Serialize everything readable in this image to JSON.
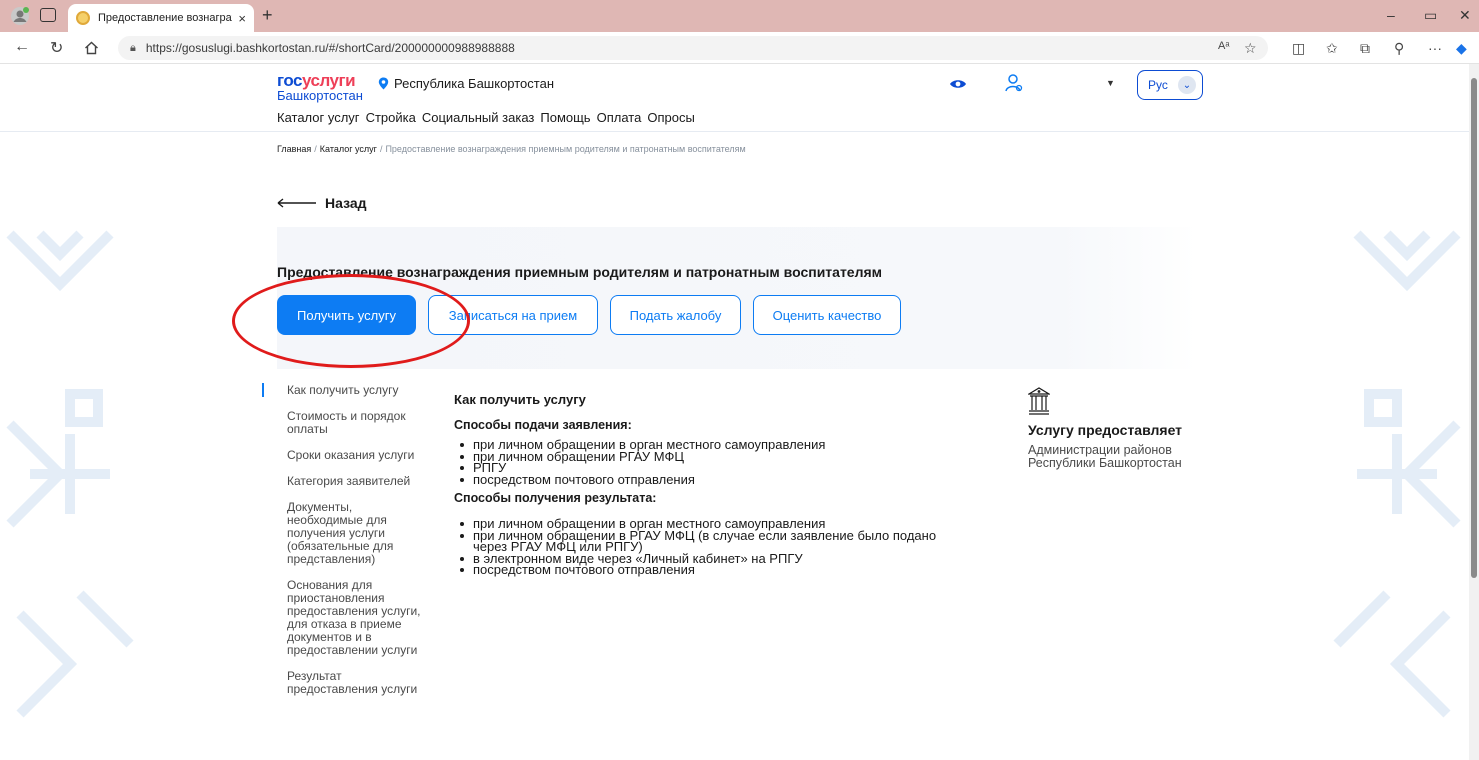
{
  "browser": {
    "tab_title": "Предоставление вознагражден",
    "tab_close": "×",
    "new_tab": "+",
    "url": "https://gosuslugi.bashkortostan.ru/#/shortCard/200000000988988888",
    "controls": {
      "minimize": "–",
      "maximize": "▭",
      "close": "✕"
    },
    "toolbar_icons": [
      "read-aloud-icon",
      "favorite-star-icon",
      "split-screen-icon",
      "favorites-icon",
      "collections-icon",
      "extensions-icon",
      "more-icon",
      "copilot-icon"
    ]
  },
  "header": {
    "logo_line1_a": "гос",
    "logo_line1_b": "услуги",
    "logo_line2": "Башкортостан",
    "region": "Республика Башкортостан",
    "language": "Рус",
    "nav": [
      "Каталог услуг",
      "Стройка",
      "Социальный заказ",
      "Помощь",
      "Оплата",
      "Опросы"
    ]
  },
  "breadcrumb": {
    "home": "Главная",
    "catalog": "Каталог услуг",
    "separator": "/",
    "current": "Предоставление вознаграждения приемным родителям и патронатным воспитателям"
  },
  "back_label": "Назад",
  "service": {
    "title": "Предоставление вознаграждения приемным родителям и патронатным воспитателям",
    "get_service": "Получить услугу",
    "appointment": "Записаться на прием",
    "complaint": "Подать жалобу",
    "rate": "Оценить качество"
  },
  "sidenav": [
    "Как получить услугу",
    "Стоимость и порядок оплаты",
    "Сроки оказания услуги",
    "Категория заявителей",
    "Документы, необходимые для получения услуги (обязательные для представления)",
    "Основания для приостановления предоставления услуги, для отказа в приеме документов и в предоставлении услуги",
    "Результат предоставления услуги"
  ],
  "content": {
    "heading": "Как получить услугу",
    "submit_heading": "Способы подачи заявления:",
    "submit_items": [
      "при личном обращении в орган местного самоуправления",
      "при личном обращении РГАУ МФЦ",
      "РПГУ",
      "посредством почтового отправления"
    ],
    "result_heading": "Способы получения результата:",
    "result_items": [
      "при личном обращении в орган местного самоуправления",
      "при личном обращении в РГАУ МФЦ (в случае если заявление было подано",
      "через РГАУ МФЦ или РПГУ)",
      "в электронном виде через «Личный кабинет» на РПГУ",
      "посредством почтового отправления"
    ]
  },
  "provider": {
    "title": "Услугу предоставляет",
    "line1": "Администрации районов",
    "line2": "Республики Башкортостан"
  },
  "colors": {
    "brand_blue": "#0d4cd3",
    "button_blue": "#0d7cf3",
    "brand_red": "#ee3f58",
    "highlight_red": "#e01b1b",
    "tab_strip": "#dfb7b4"
  }
}
